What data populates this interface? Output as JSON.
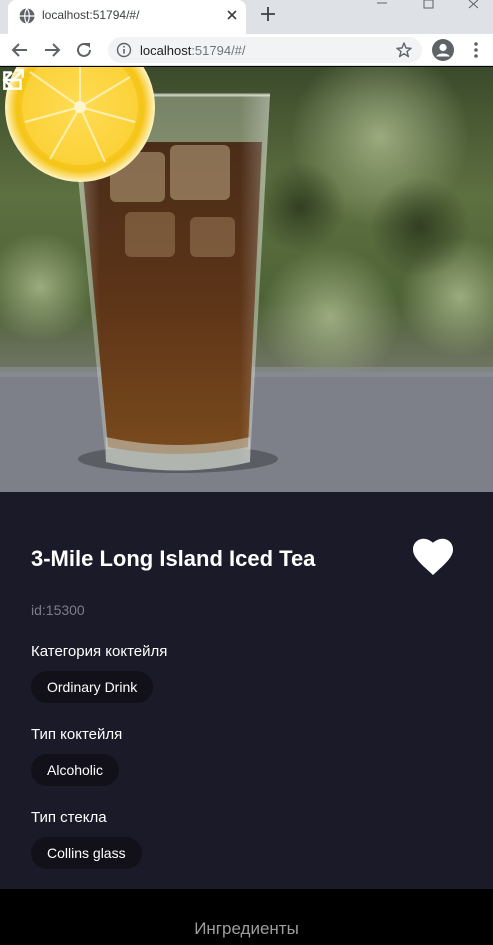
{
  "browser": {
    "tab_title": "localhost:51794/#/",
    "url_host": "localhost",
    "url_rest": ":51794/#/"
  },
  "drink": {
    "title": "3-Mile Long Island Iced Tea",
    "id_text": "id:15300",
    "favorite": true
  },
  "sections": [
    {
      "label": "Категория коктейля",
      "value": "Ordinary Drink"
    },
    {
      "label": "Тип коктейля",
      "value": "Alcoholic"
    },
    {
      "label": "Тип стекла",
      "value": "Collins glass"
    }
  ],
  "footer": {
    "title": "Ингредиенты"
  },
  "icons": {
    "back": "arrow-back-icon",
    "open": "open-in-new-icon",
    "favorite": "heart-icon"
  },
  "colors": {
    "panel": "#1b1a28",
    "chip": "#121119",
    "id": "#7d7c8a"
  }
}
